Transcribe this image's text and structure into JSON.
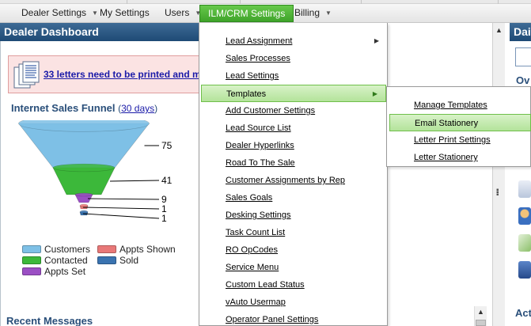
{
  "menubar": {
    "items": [
      {
        "label": "Dealer Settings",
        "has_caret": true
      },
      {
        "label": "My Settings",
        "has_caret": false
      },
      {
        "label": "Users",
        "has_caret": true
      },
      {
        "label": "ILM/CRM Settings",
        "has_caret": false,
        "active": true
      },
      {
        "label": "Billing",
        "has_caret": true
      }
    ]
  },
  "left_panel": {
    "title": "Dealer Dashboard",
    "alert": {
      "icon": "documents-icon",
      "text": "33 letters need to be printed and ma"
    },
    "funnel": {
      "title": "Internet Sales Funnel",
      "paren_open": "(",
      "period_link": "30 days",
      "paren_close": ")"
    },
    "recent_messages_title": "Recent Messages"
  },
  "chart_data": {
    "type": "funnel",
    "title": "Internet Sales Funnel",
    "categories": [
      "Customers",
      "Contacted",
      "Appts Set",
      "Appts Shown",
      "Sold"
    ],
    "values": [
      75,
      41,
      9,
      1,
      1
    ],
    "labels": [
      "75",
      "41",
      "9",
      "1",
      "1"
    ],
    "colors": [
      "#7ec0e6",
      "#3cb83a",
      "#9b4fc4",
      "#e87878",
      "#3a73b0"
    ],
    "legend": {
      "placement": "bottom",
      "entries": [
        {
          "name": "Customers",
          "color": "#7ec0e6"
        },
        {
          "name": "Appts Shown",
          "color": "#e87878"
        },
        {
          "name": "Contacted",
          "color": "#3cb83a"
        },
        {
          "name": "Sold",
          "color": "#3a73b0"
        },
        {
          "name": "Appts Set",
          "color": "#9b4fc4"
        }
      ]
    }
  },
  "dropdown": {
    "items": [
      {
        "label": "Lead Assignment",
        "has_submenu": true
      },
      {
        "label": "Sales Processes"
      },
      {
        "label": "Lead Settings"
      },
      {
        "label": "Templates",
        "has_submenu": true,
        "highlighted": true
      },
      {
        "label": "Add Customer Settings"
      },
      {
        "label": "Lead Source List"
      },
      {
        "label": "Dealer Hyperlinks"
      },
      {
        "label": "Road To The Sale"
      },
      {
        "label": "Customer Assignments by Rep"
      },
      {
        "label": "Sales Goals"
      },
      {
        "label": "Desking Settings"
      },
      {
        "label": "Task Count List"
      },
      {
        "label": "RO OpCodes"
      },
      {
        "label": "Service Menu"
      },
      {
        "label": "Custom Lead Status"
      },
      {
        "label": "vAuto Usermap"
      },
      {
        "label": "Operator Panel Settings"
      }
    ]
  },
  "submenu": {
    "items": [
      {
        "label": "Manage Templates"
      },
      {
        "label": "Email Stationery",
        "highlighted": true
      },
      {
        "label": "Letter Print Settings"
      },
      {
        "label": "Letter Stationery"
      }
    ]
  },
  "right_panel": {
    "title": "Dai",
    "section_1": "Ov",
    "section_2": "Act"
  }
}
